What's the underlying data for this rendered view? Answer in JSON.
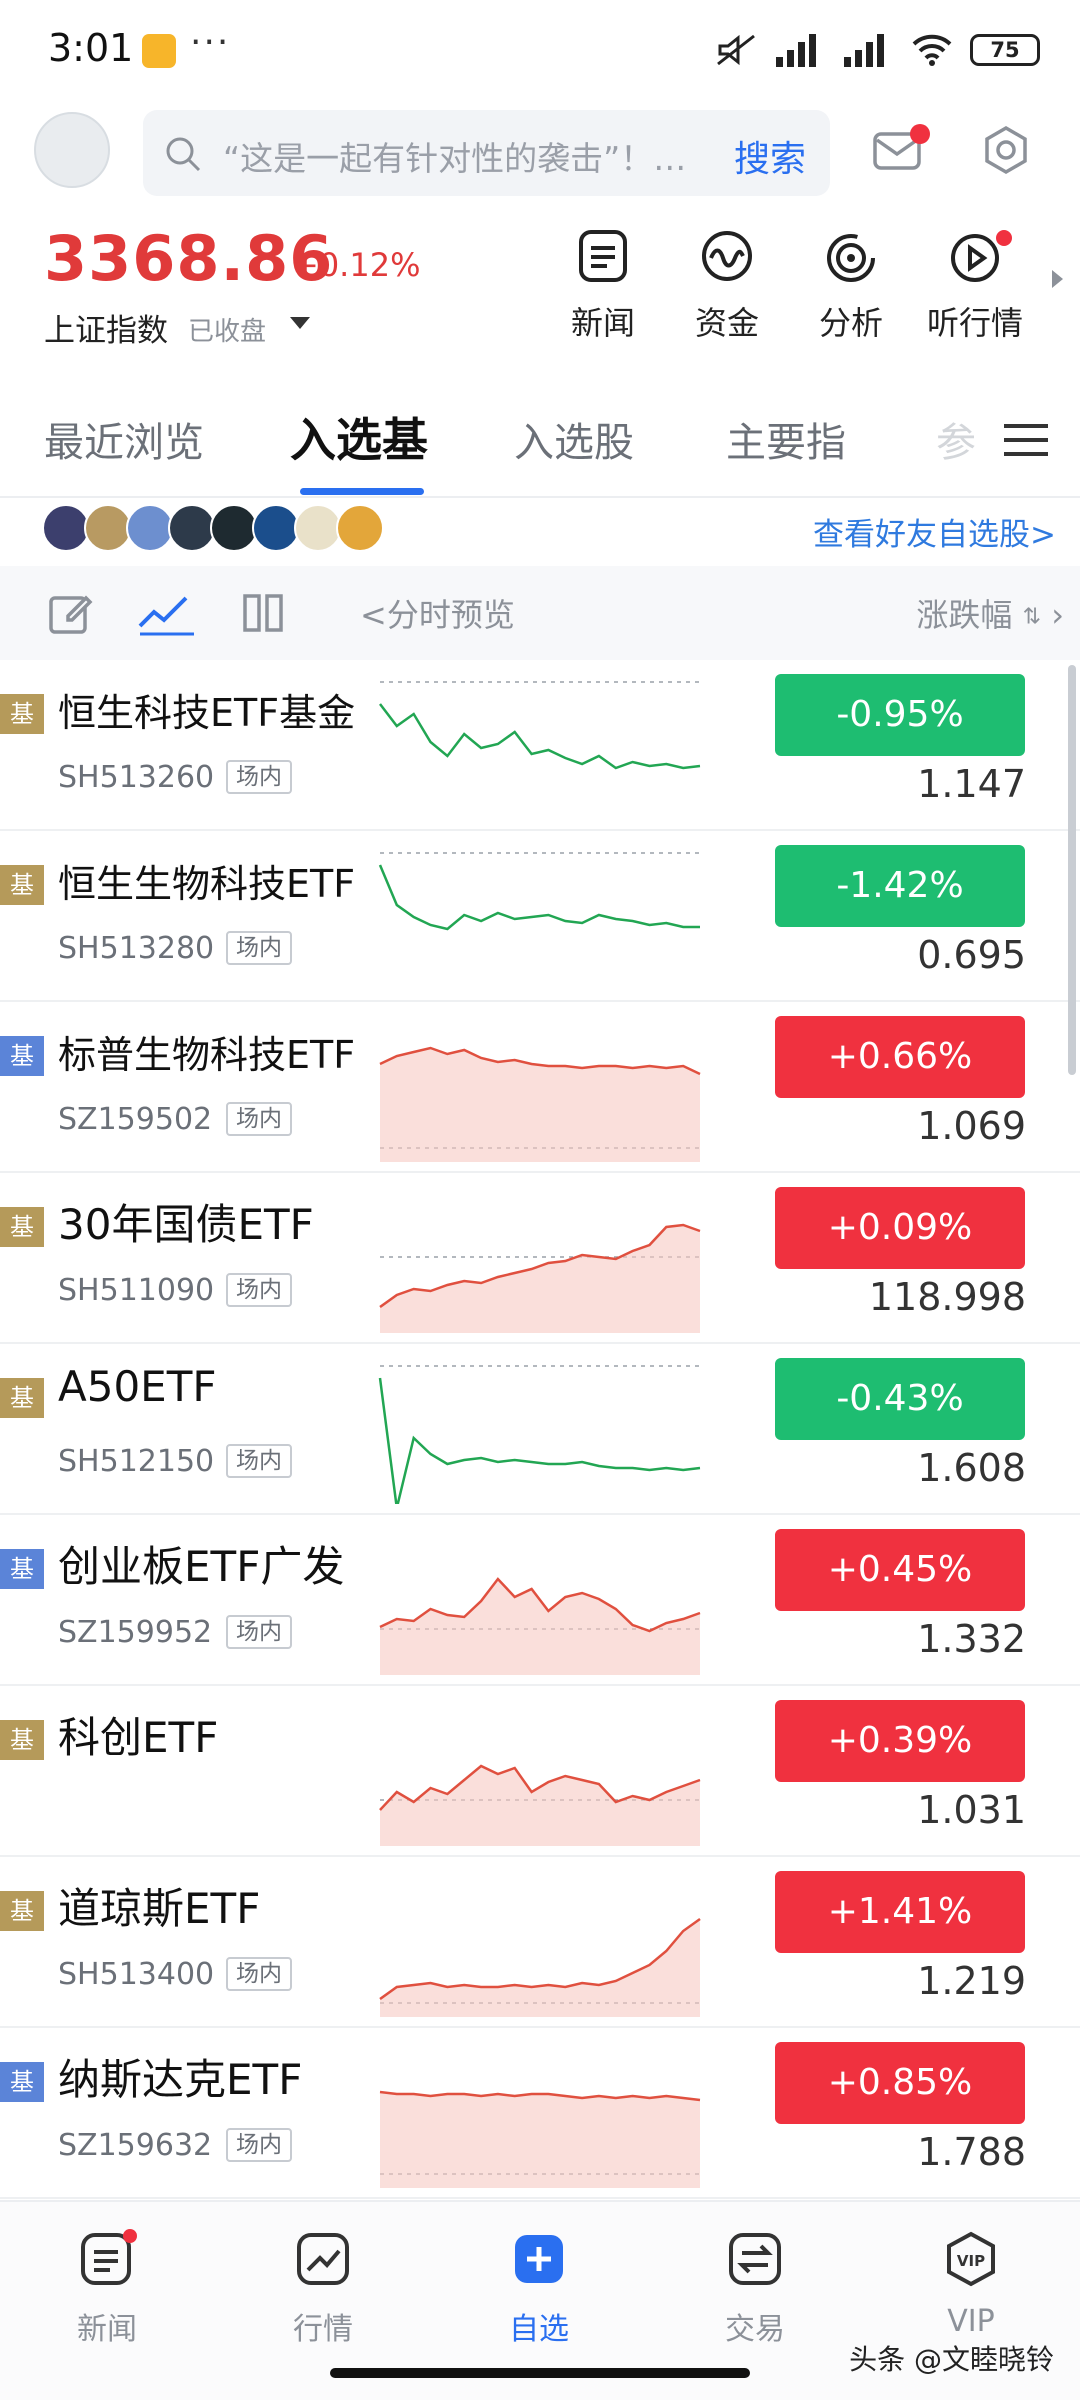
{
  "status_bar": {
    "time": "3:01",
    "battery": "75"
  },
  "search": {
    "placeholder": "“这是一起有针对性的袭击”！…",
    "button": "搜索"
  },
  "index": {
    "value": "3368.86",
    "change": "+0.12%",
    "name": "上证指数",
    "status": "已收盘"
  },
  "quick_nav": [
    "新闻",
    "资金",
    "分析",
    "听行情"
  ],
  "tabs": [
    {
      "label": "最近浏览",
      "active": false
    },
    {
      "label": "入选基",
      "active": true
    },
    {
      "label": "入选股",
      "active": false
    },
    {
      "label": "主要指",
      "active": false
    },
    {
      "label": "参",
      "active": false
    }
  ],
  "friends_link": "查看好友自选股>",
  "toolbar": {
    "preview": "<分时预览",
    "sort": "涨跌幅"
  },
  "funds": [
    {
      "badge": "基",
      "name": "恒生科技ETF基金",
      "code": "SH513260",
      "market": "场内",
      "change": "-0.95%",
      "direction": "down",
      "price": "1.147"
    },
    {
      "badge": "基",
      "name": "恒生生物科技ETF",
      "code": "SH513280",
      "market": "场内",
      "change": "-1.42%",
      "direction": "down",
      "price": "0.695"
    },
    {
      "badge": "基",
      "name": "标普生物科技ETF",
      "code": "SZ159502",
      "market": "场内",
      "change": "+0.66%",
      "direction": "up",
      "price": "1.069"
    },
    {
      "badge": "基",
      "name": "30年国债ETF",
      "code": "SH511090",
      "market": "场内",
      "change": "+0.09%",
      "direction": "up",
      "price": "118.998"
    },
    {
      "badge": "基",
      "name": "A50ETF",
      "code": "SH512150",
      "market": "场内",
      "change": "-0.43%",
      "direction": "down",
      "price": "1.608"
    },
    {
      "badge": "基",
      "name": "创业板ETF广发",
      "code": "SZ159952",
      "market": "场内",
      "change": "+0.45%",
      "direction": "up",
      "price": "1.332"
    },
    {
      "badge": "基",
      "name": "科创ETF",
      "code": "",
      "market": "",
      "change": "+0.39%",
      "direction": "up",
      "price": "1.031"
    },
    {
      "badge": "基",
      "name": "道琼斯ETF",
      "code": "SH513400",
      "market": "场内",
      "change": "+1.41%",
      "direction": "up",
      "price": "1.219"
    },
    {
      "badge": "基",
      "name": "纳斯达克ETF",
      "code": "SZ159632",
      "market": "场内",
      "change": "+0.85%",
      "direction": "up",
      "price": "1.788"
    }
  ],
  "bottom_nav": [
    {
      "label": "新闻",
      "active": false
    },
    {
      "label": "行情",
      "active": false
    },
    {
      "label": "自选",
      "active": true
    },
    {
      "label": "交易",
      "active": false
    },
    {
      "label": "VIP",
      "active": false
    }
  ],
  "watermark": "头条 @文睦晓铃",
  "colors": {
    "up": "#f0313f",
    "down": "#1ebd71",
    "accent": "#2a6ff0",
    "index": "#e03a3a"
  }
}
